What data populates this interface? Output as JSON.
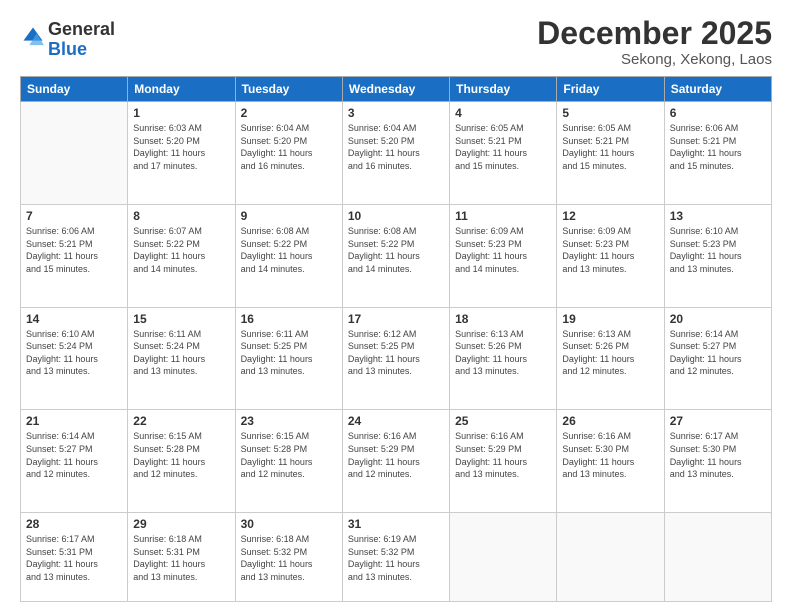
{
  "logo": {
    "general": "General",
    "blue": "Blue"
  },
  "title": "December 2025",
  "subtitle": "Sekong, Xekong, Laos",
  "headers": [
    "Sunday",
    "Monday",
    "Tuesday",
    "Wednesday",
    "Thursday",
    "Friday",
    "Saturday"
  ],
  "weeks": [
    [
      {
        "day": "",
        "info": ""
      },
      {
        "day": "1",
        "info": "Sunrise: 6:03 AM\nSunset: 5:20 PM\nDaylight: 11 hours\nand 17 minutes."
      },
      {
        "day": "2",
        "info": "Sunrise: 6:04 AM\nSunset: 5:20 PM\nDaylight: 11 hours\nand 16 minutes."
      },
      {
        "day": "3",
        "info": "Sunrise: 6:04 AM\nSunset: 5:20 PM\nDaylight: 11 hours\nand 16 minutes."
      },
      {
        "day": "4",
        "info": "Sunrise: 6:05 AM\nSunset: 5:21 PM\nDaylight: 11 hours\nand 15 minutes."
      },
      {
        "day": "5",
        "info": "Sunrise: 6:05 AM\nSunset: 5:21 PM\nDaylight: 11 hours\nand 15 minutes."
      },
      {
        "day": "6",
        "info": "Sunrise: 6:06 AM\nSunset: 5:21 PM\nDaylight: 11 hours\nand 15 minutes."
      }
    ],
    [
      {
        "day": "7",
        "info": "Sunrise: 6:06 AM\nSunset: 5:21 PM\nDaylight: 11 hours\nand 15 minutes."
      },
      {
        "day": "8",
        "info": "Sunrise: 6:07 AM\nSunset: 5:22 PM\nDaylight: 11 hours\nand 14 minutes."
      },
      {
        "day": "9",
        "info": "Sunrise: 6:08 AM\nSunset: 5:22 PM\nDaylight: 11 hours\nand 14 minutes."
      },
      {
        "day": "10",
        "info": "Sunrise: 6:08 AM\nSunset: 5:22 PM\nDaylight: 11 hours\nand 14 minutes."
      },
      {
        "day": "11",
        "info": "Sunrise: 6:09 AM\nSunset: 5:23 PM\nDaylight: 11 hours\nand 14 minutes."
      },
      {
        "day": "12",
        "info": "Sunrise: 6:09 AM\nSunset: 5:23 PM\nDaylight: 11 hours\nand 13 minutes."
      },
      {
        "day": "13",
        "info": "Sunrise: 6:10 AM\nSunset: 5:23 PM\nDaylight: 11 hours\nand 13 minutes."
      }
    ],
    [
      {
        "day": "14",
        "info": "Sunrise: 6:10 AM\nSunset: 5:24 PM\nDaylight: 11 hours\nand 13 minutes."
      },
      {
        "day": "15",
        "info": "Sunrise: 6:11 AM\nSunset: 5:24 PM\nDaylight: 11 hours\nand 13 minutes."
      },
      {
        "day": "16",
        "info": "Sunrise: 6:11 AM\nSunset: 5:25 PM\nDaylight: 11 hours\nand 13 minutes."
      },
      {
        "day": "17",
        "info": "Sunrise: 6:12 AM\nSunset: 5:25 PM\nDaylight: 11 hours\nand 13 minutes."
      },
      {
        "day": "18",
        "info": "Sunrise: 6:13 AM\nSunset: 5:26 PM\nDaylight: 11 hours\nand 13 minutes."
      },
      {
        "day": "19",
        "info": "Sunrise: 6:13 AM\nSunset: 5:26 PM\nDaylight: 11 hours\nand 12 minutes."
      },
      {
        "day": "20",
        "info": "Sunrise: 6:14 AM\nSunset: 5:27 PM\nDaylight: 11 hours\nand 12 minutes."
      }
    ],
    [
      {
        "day": "21",
        "info": "Sunrise: 6:14 AM\nSunset: 5:27 PM\nDaylight: 11 hours\nand 12 minutes."
      },
      {
        "day": "22",
        "info": "Sunrise: 6:15 AM\nSunset: 5:28 PM\nDaylight: 11 hours\nand 12 minutes."
      },
      {
        "day": "23",
        "info": "Sunrise: 6:15 AM\nSunset: 5:28 PM\nDaylight: 11 hours\nand 12 minutes."
      },
      {
        "day": "24",
        "info": "Sunrise: 6:16 AM\nSunset: 5:29 PM\nDaylight: 11 hours\nand 12 minutes."
      },
      {
        "day": "25",
        "info": "Sunrise: 6:16 AM\nSunset: 5:29 PM\nDaylight: 11 hours\nand 13 minutes."
      },
      {
        "day": "26",
        "info": "Sunrise: 6:16 AM\nSunset: 5:30 PM\nDaylight: 11 hours\nand 13 minutes."
      },
      {
        "day": "27",
        "info": "Sunrise: 6:17 AM\nSunset: 5:30 PM\nDaylight: 11 hours\nand 13 minutes."
      }
    ],
    [
      {
        "day": "28",
        "info": "Sunrise: 6:17 AM\nSunset: 5:31 PM\nDaylight: 11 hours\nand 13 minutes."
      },
      {
        "day": "29",
        "info": "Sunrise: 6:18 AM\nSunset: 5:31 PM\nDaylight: 11 hours\nand 13 minutes."
      },
      {
        "day": "30",
        "info": "Sunrise: 6:18 AM\nSunset: 5:32 PM\nDaylight: 11 hours\nand 13 minutes."
      },
      {
        "day": "31",
        "info": "Sunrise: 6:19 AM\nSunset: 5:32 PM\nDaylight: 11 hours\nand 13 minutes."
      },
      {
        "day": "",
        "info": ""
      },
      {
        "day": "",
        "info": ""
      },
      {
        "day": "",
        "info": ""
      }
    ]
  ]
}
